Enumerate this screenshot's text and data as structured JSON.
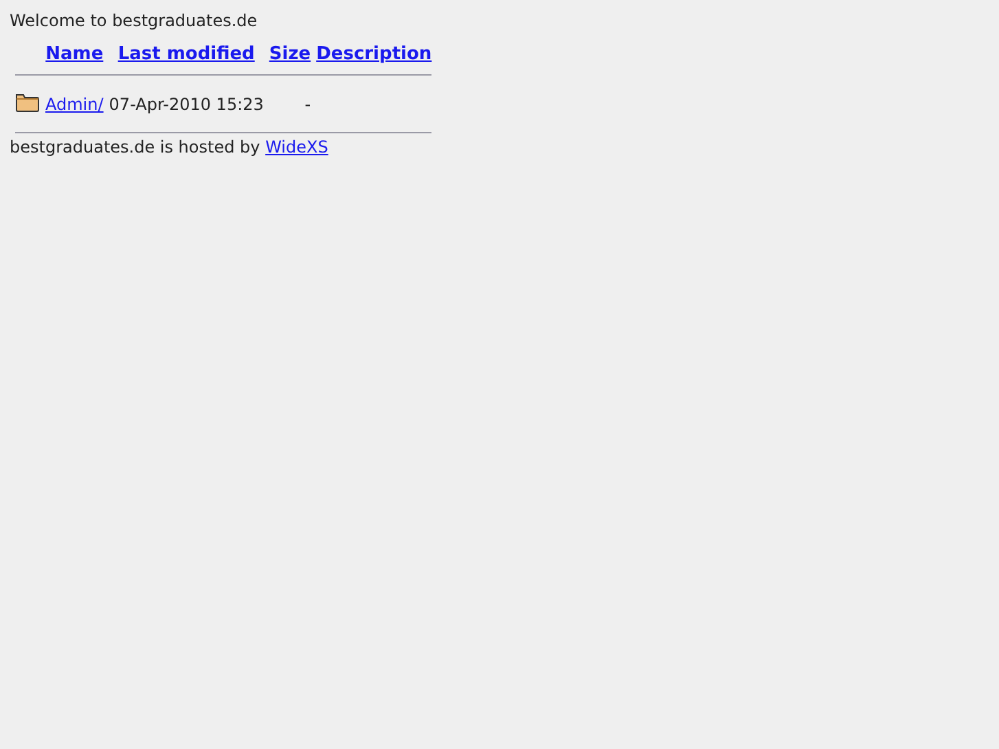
{
  "welcome": "Welcome to bestgraduates.de",
  "columns": [
    "Name",
    "Last modified",
    "Size",
    "Description"
  ],
  "rows": [
    {
      "kind": "folder",
      "name": "Admin/",
      "modified": "07-Apr-2010 15:23",
      "size": "-"
    }
  ],
  "footer": {
    "text": "bestgraduates.de is hosted by",
    "link": "WideXS"
  }
}
